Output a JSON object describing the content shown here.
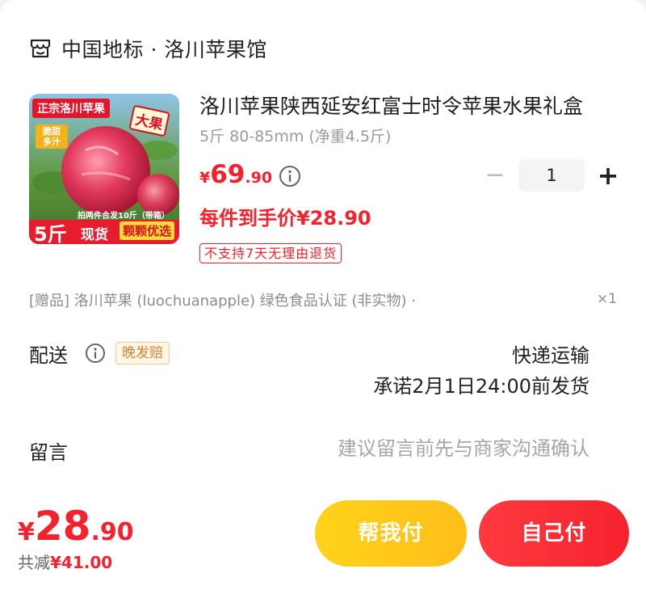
{
  "shop": {
    "name": "中国地标 · 洛川苹果馆",
    "icon": "shop-icon"
  },
  "product": {
    "title": "洛川苹果陕西延安红富士时令苹果水果礼盒",
    "spec": "5斤 80-85mm (净重4.5斤)",
    "price": {
      "symbol": "¥",
      "integer": "69",
      "decimal": ".90"
    },
    "unit_price": "每件到手价¥28.90",
    "return_policy": "不支持7天无理由退货",
    "quantity": "1",
    "image": {
      "banner": "正宗洛川苹果",
      "big_label": "大果",
      "side_label_1": "脆甜",
      "side_label_2": "多汁",
      "promo_line": "拍两件合发10斤（带箱）",
      "weight": "5斤",
      "tag_1": "现货",
      "tag_2": "颗颗优选"
    }
  },
  "gift": {
    "text": "[赠品] 洛川苹果 (luochuanapple) 绿色食品认证 (非实物) ·",
    "qty": "×1"
  },
  "shipping": {
    "label": "配送",
    "late_badge": "晚发赔",
    "method": "快递运输",
    "promise": "承诺2月1日24:00前发货"
  },
  "message": {
    "label": "留言",
    "placeholder": "建议留言前先与商家沟通确认",
    "value": ""
  },
  "footer": {
    "total": {
      "symbol": "¥",
      "integer": "28",
      "decimal": ".90"
    },
    "discount_label": "共减",
    "discount_amount": "¥41.00",
    "help_pay": "帮我付",
    "self_pay": "自己付"
  },
  "colors": {
    "accent": "#f5222d",
    "help_button": "#ffc61a",
    "late_badge": "#d9822b"
  }
}
